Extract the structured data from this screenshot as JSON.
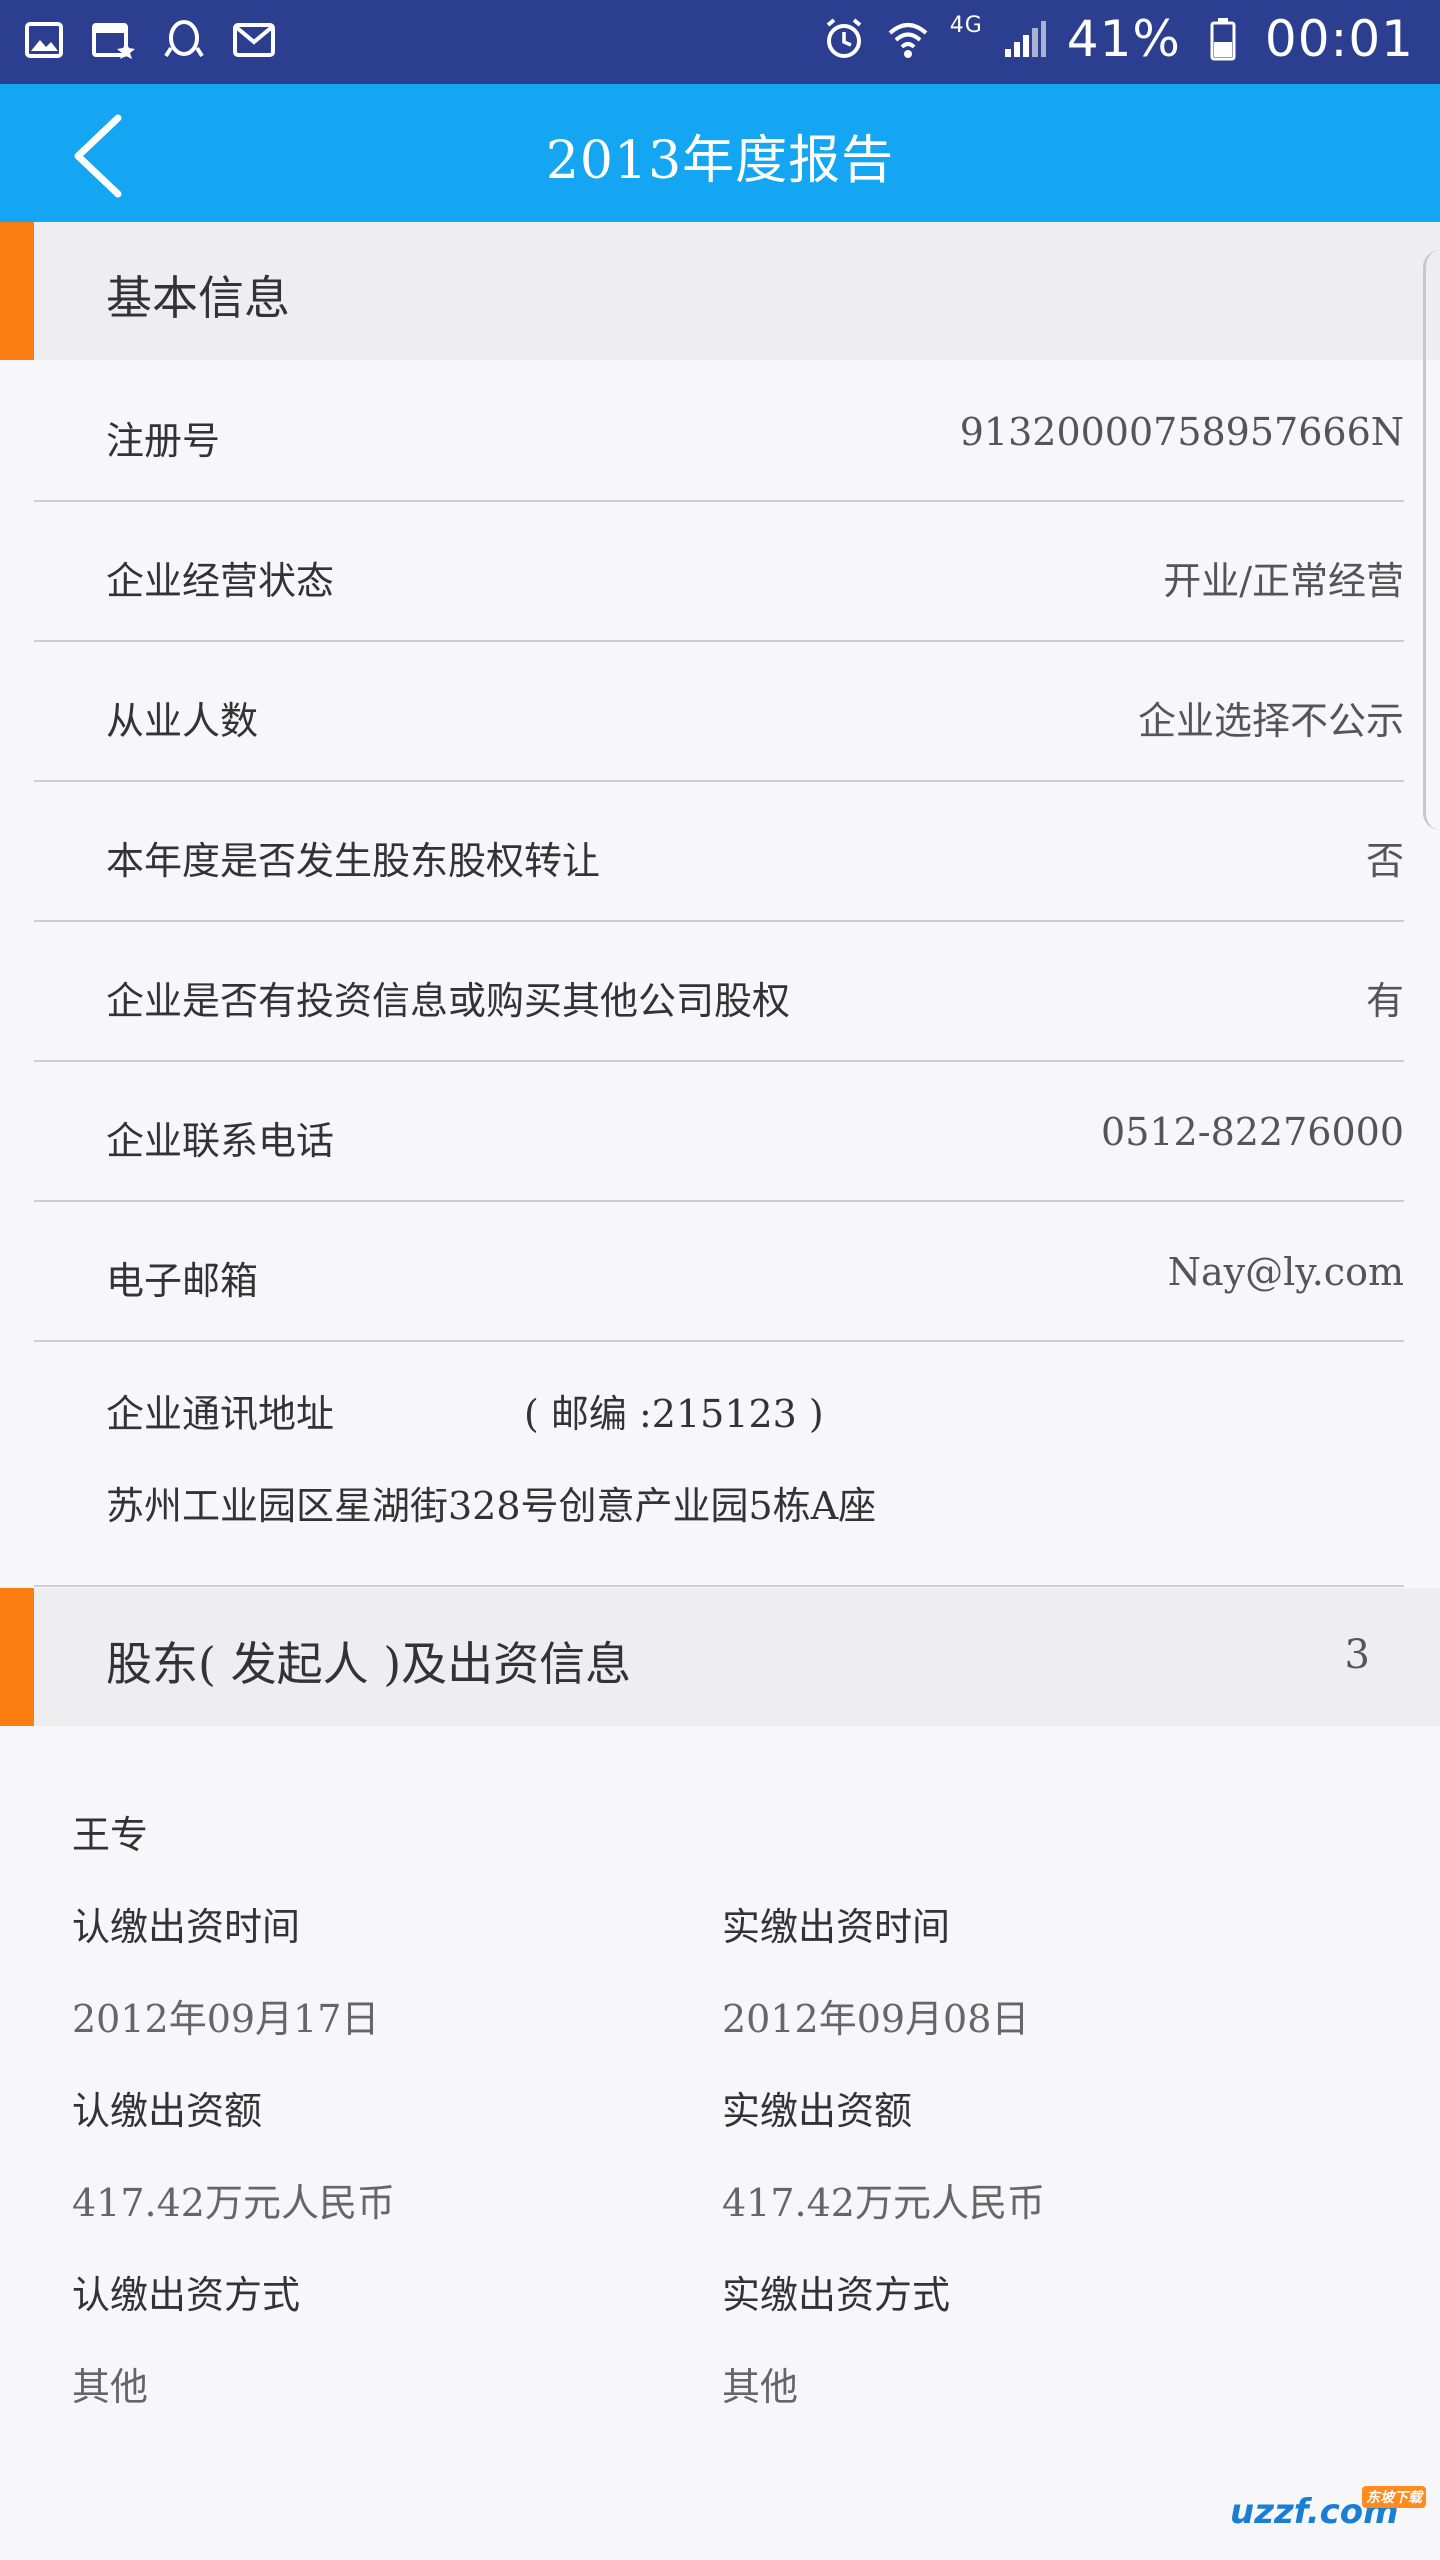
{
  "status_bar": {
    "battery": "41%",
    "time": "00:01",
    "network": "4G",
    "icons": [
      "gallery-icon",
      "calendar-icon",
      "qq-icon",
      "mail-icon",
      "alarm-icon",
      "wifi-icon",
      "signal-icon",
      "battery-icon"
    ]
  },
  "header": {
    "title": "2013年度报告",
    "back_icon": "chevron-left-icon"
  },
  "basic_info": {
    "title": "基本信息",
    "rows": [
      {
        "label": "注册号",
        "value": "91320000758957666N"
      },
      {
        "label": "企业经营状态",
        "value": "开业/正常经营"
      },
      {
        "label": "从业人数",
        "value": "企业选择不公示"
      },
      {
        "label": "本年度是否发生股东股权转让",
        "value": "否"
      },
      {
        "label": "企业是否有投资信息或购买其他公司股权",
        "value": "有"
      },
      {
        "label": "企业联系电话",
        "value": "0512-82276000"
      },
      {
        "label": "电子邮箱",
        "value": "Nay@ly.com"
      }
    ],
    "address": {
      "label": "企业通讯地址",
      "zip": "( 邮编 :215123 )",
      "value": "苏州工业园区星湖街328号创意产业园5栋A座"
    }
  },
  "shareholders": {
    "title": "股东( 发起人 )及出资信息",
    "count": "3",
    "items": [
      {
        "name": "王专",
        "subscribed_time_label": "认缴出资时间",
        "subscribed_time": "2012年09月17日",
        "paid_time_label": "实缴出资时间",
        "paid_time": "2012年09月08日",
        "subscribed_amount_label": "认缴出资额",
        "subscribed_amount": "417.42万元人民币",
        "paid_amount_label": "实缴出资额",
        "paid_amount": "417.42万元人民币",
        "subscribed_method_label": "认缴出资方式",
        "subscribed_method": "其他",
        "paid_method_label": "实缴出资方式",
        "paid_method": "其他"
      }
    ]
  },
  "watermark": {
    "text": "uzzf.com",
    "badge": "东坡下载"
  },
  "colors": {
    "status_bar": "#2c3e8f",
    "app_bar": "#14a6f3",
    "section_accent": "#fb7d12",
    "section_bg": "#eeeef0"
  }
}
